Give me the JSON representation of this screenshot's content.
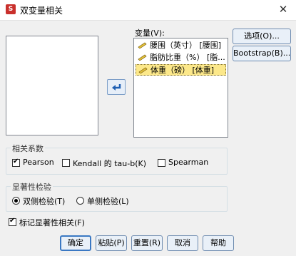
{
  "window": {
    "title": "双变量相关",
    "close_glyph": "✕"
  },
  "variables": {
    "label": "变量(V):",
    "items": [
      {
        "label": "腰围（英寸） [腰围]",
        "selected": false
      },
      {
        "label": "脂肪比重（%） [脂...",
        "selected": false
      },
      {
        "label": "体重（磅） [体重]",
        "selected": true
      }
    ]
  },
  "side_buttons": {
    "options": "选项(O)...",
    "bootstrap": "Bootstrap(B)..."
  },
  "correlation": {
    "legend": "相关系数",
    "pearson": {
      "label": "Pearson",
      "checked": true
    },
    "kendall": {
      "label": "Kendall 的 tau-b(K)",
      "checked": false
    },
    "spearman": {
      "label": "Spearman",
      "checked": false
    }
  },
  "significance": {
    "legend": "显著性检验",
    "two_tailed": {
      "label": "双侧检验(T)",
      "checked": true
    },
    "one_tailed": {
      "label": "单侧检验(L)",
      "checked": false
    }
  },
  "flag": {
    "label": "标记显著性相关(F)",
    "checked": true
  },
  "buttons": {
    "ok": "确定",
    "paste": "粘贴(P)",
    "reset": "重置(R)",
    "cancel": "取消",
    "help": "帮助"
  },
  "colors": {
    "selected_row": "#fce88a",
    "accent": "#3a78c3"
  }
}
